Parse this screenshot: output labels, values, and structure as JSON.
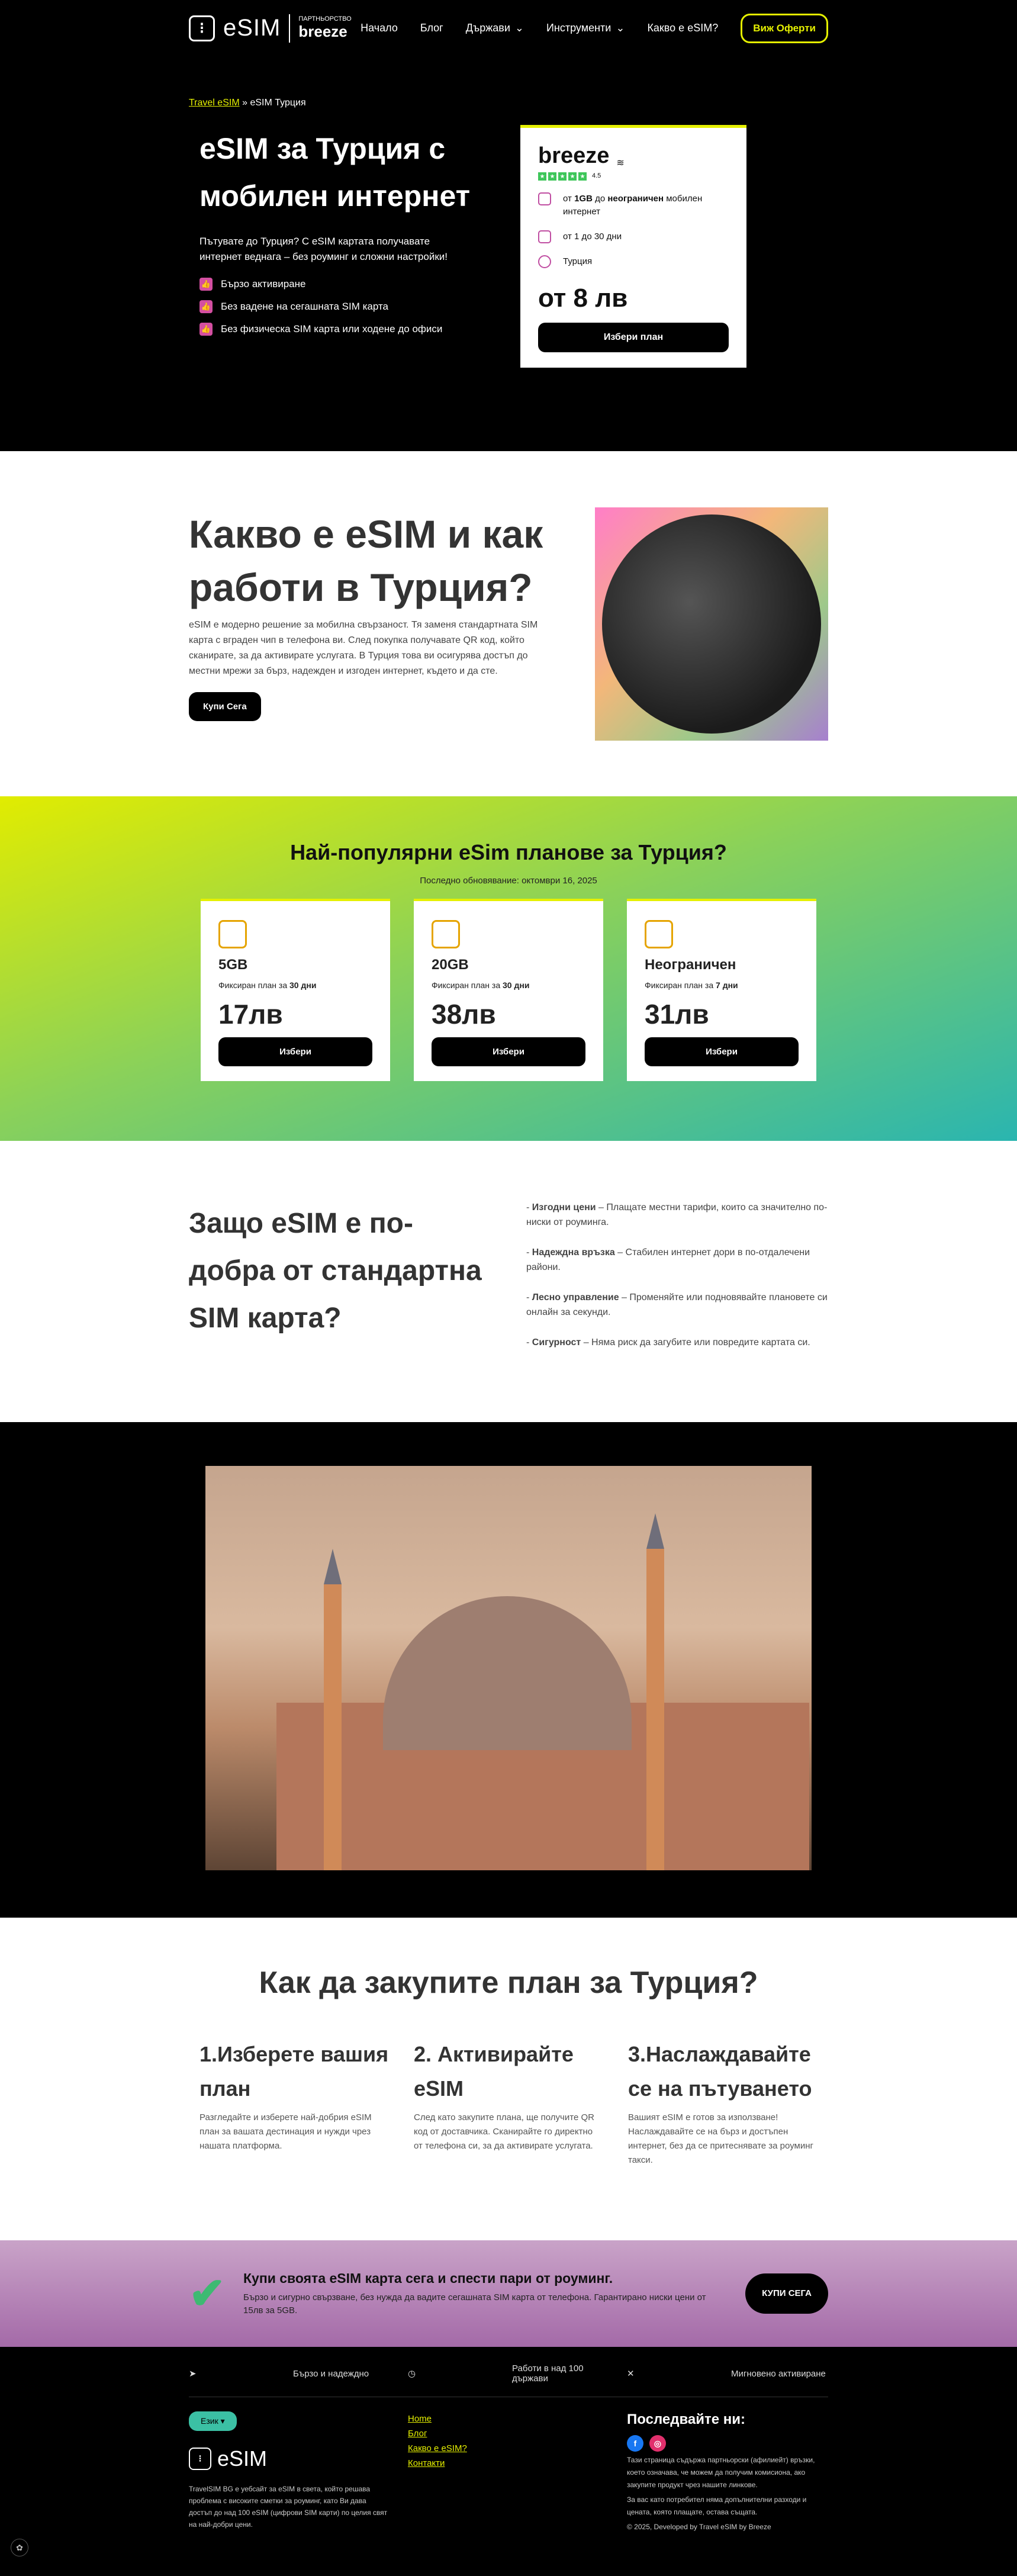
{
  "header": {
    "logo_text": "eSIM",
    "logo_sub": "ПАРТНЬОРСТВО",
    "logo_brand": "breeze",
    "nav": [
      "Начало",
      "Блог",
      "Държави",
      "Инструменти",
      "Какво е eSIM?"
    ],
    "cta": "Виж Оферти"
  },
  "hero": {
    "crumb_link": "Travel eSIM",
    "crumb_current": "eSIM Турция",
    "title": "eSIM за Турция с мобилен интернет",
    "lead": "Пътувате до Турция? С eSIM картата получавате интернет веднага – без роуминг и сложни настройки!",
    "bullets": [
      "Бързо активиране",
      "Без ваденe на сегашната SIM карта",
      "Без физическа SIM карта или ходене до офиси"
    ],
    "card": {
      "brand": "breeze",
      "rating": "4.5",
      "data_prefix": "от ",
      "data_from": "1GB",
      "data_mid": " до ",
      "data_to": "неограничен",
      "data_suffix": " мобилен интернет",
      "days": "от 1 до 30 дни",
      "country": "Турция",
      "price": "от 8 лв",
      "button": "Избери план"
    }
  },
  "what": {
    "title": "Какво е eSIM и как работи в Турция?",
    "text": "eSIM е модерно решение за мобилна свързаност. Тя заменя стандартната SIM карта с вграден чип в телефона ви. След покупка получавате QR код, който сканирате, за да активирате услугата. В Турция това ви осигурява достъп до местни мрежи за бърз, надежден и изгоден интернет, където и да сте.",
    "button": "Купи Сега"
  },
  "plans": {
    "title": "Най-популярни eSim планове за Турция?",
    "updated": "Последно обновявание: октомври 16, 2025",
    "items": [
      {
        "name": "5GB",
        "sub_prefix": "Фиксиран план за ",
        "sub_days": "30 дни",
        "price": "17лв",
        "button": "Избери"
      },
      {
        "name": "20GB",
        "sub_prefix": "Фиксиран план за ",
        "sub_days": "30 дни",
        "price": "38лв",
        "button": "Избери"
      },
      {
        "name": "Неограничен",
        "sub_prefix": "Фиксиран план за ",
        "sub_days": "7 дни",
        "price": "31лв",
        "button": "Избери"
      }
    ]
  },
  "why": {
    "title": "Защо eSIM е по-добра от стандартна SIM карта?",
    "items": [
      {
        "label": "Изгодни цени",
        "text": " – Плащате местни тарифи, които са значително по-ниски от роуминга."
      },
      {
        "label": "Надеждна връзка",
        "text": " – Стабилен интернет дори в по-отдалечени райони."
      },
      {
        "label": "Лесно управление",
        "text": " – Променяйте или подновявайте плановете си онлайн за секунди."
      },
      {
        "label": "Сигурност",
        "text": " – Няма риск да загубите или повредите картата си."
      }
    ]
  },
  "how": {
    "title": "Как да закупите план за Турция?",
    "steps": [
      {
        "title": "1.Изберете вашия план",
        "text": "Разгледайте и изберете най-добрия eSIM план за вашата дестинация и нужди чрез нашата платформа."
      },
      {
        "title": "2. Активирайте eSIM",
        "text": "След като закупите плана, ще получите QR код от доставчика. Сканирайте го директно от телефона си, за да активирате услугата."
      },
      {
        "title": "3.Наслаждавайте се на пътуването",
        "text": "Вашият eSIM е готов за използване! Наслаждавайте се на бърз и достъпен интернет, без да се притеснявате за роуминг такси."
      }
    ]
  },
  "cta": {
    "title": "Купи своята eSIM карта сега и спести пари от роуминг.",
    "text": "Бързо и сигурно свързване, без нужда да вадите сегашната SIM карта от телефона. Гарантирано ниски цени от 15лв за 5GB.",
    "button": "КУПИ СЕГА"
  },
  "footer": {
    "features": [
      "Бързо и надеждно",
      "Работи в над 100 държави",
      "Мигновено активиране"
    ],
    "lang": "Език",
    "about": "TravelSIM BG е уебсайт за eSIM в света, който решава проблема с високите сметки за роуминг, като Ви дава достъп до над 100 eSIM (цифрови SIM карти) по целия свят на най-добри цени.",
    "links": [
      "Home",
      "Блог",
      "Какво е eSIM?",
      "Контакти"
    ],
    "follow": "Последвайте ни:",
    "disclaimer": "Тази страница съдържа партньорски (афилиейт) връзки, което означава, че можем да получим комисиона, ако закупите продукт чрез нашите линкове.",
    "disclaimer2": "За вас като потребител няма допълнителни разходи и цената, която плащате, остава същата.",
    "copyright": "© 2025, Developed by Travel eSIM by Breeze"
  }
}
